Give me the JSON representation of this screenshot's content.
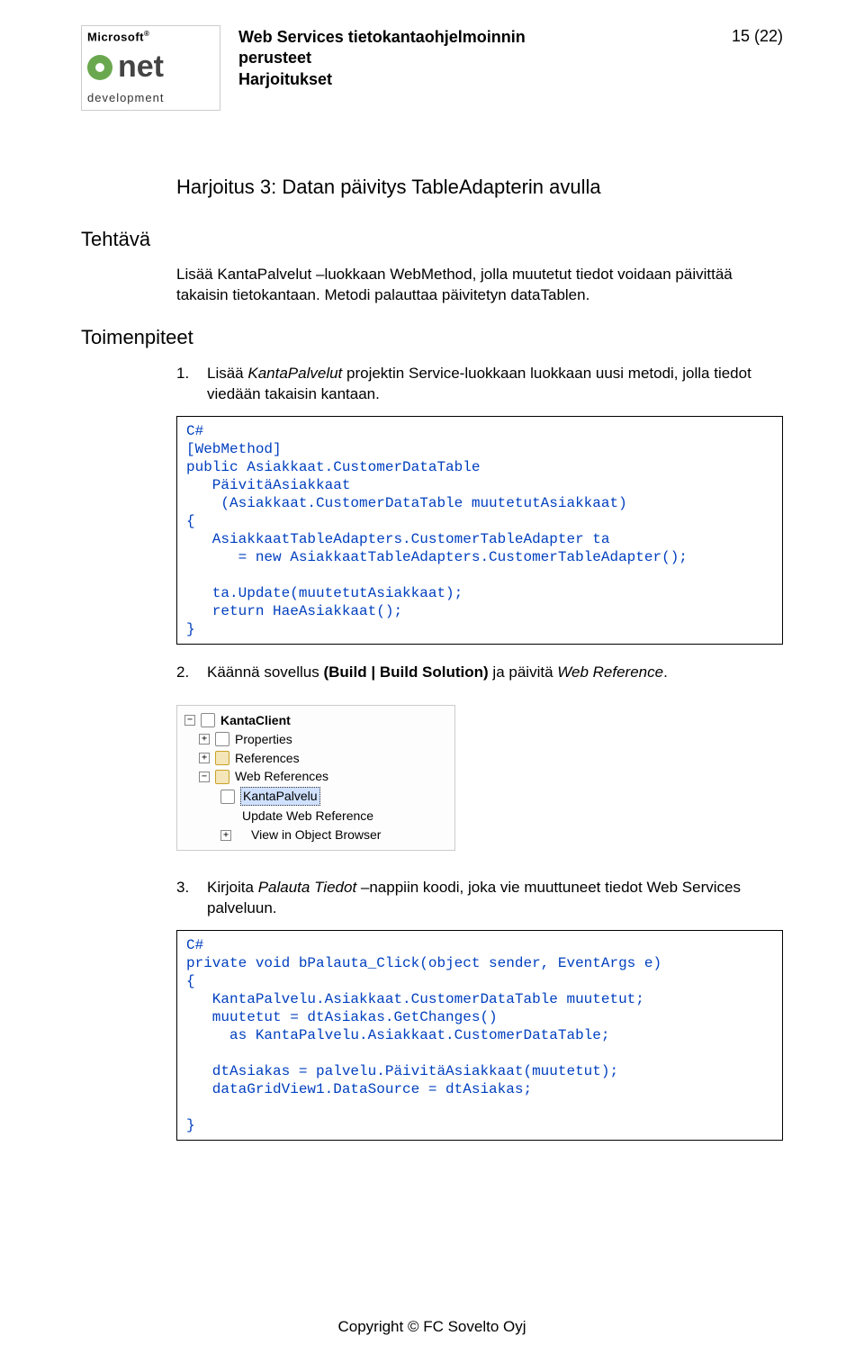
{
  "header": {
    "logo": {
      "ms": "Microsoft",
      "net": "net",
      "dev": "development"
    },
    "title_line1": "Web Services tietokantaohjelmoinnin",
    "title_line2": "perusteet",
    "title_line3": "Harjoitukset",
    "page_indicator": "15 (22)"
  },
  "exercise_title": "Harjoitus 3: Datan päivitys TableAdapterin avulla",
  "labels": {
    "task": "Tehtävä",
    "steps": "Toimenpiteet"
  },
  "task_paragraph": "Lisää KantaPalvelut –luokkaan WebMethod, jolla muutetut tiedot voidaan päivittää takaisin tietokantaan. Metodi palauttaa päivitetyn dataTablen.",
  "steps": {
    "s1_num": "1.",
    "s1_pre": "Lisää ",
    "s1_ital": "KantaPalvelut",
    "s1_post": " projektin Service-luokkaan luokkaan uusi metodi, jolla tiedot viedään takaisin kantaan.",
    "code1": "C#\n[WebMethod]\npublic Asiakkaat.CustomerDataTable\n   PäivitäAsiakkaat\n    (Asiakkaat.CustomerDataTable muutetutAsiakkaat)\n{\n   AsiakkaatTableAdapters.CustomerTableAdapter ta\n      = new AsiakkaatTableAdapters.CustomerTableAdapter();\n\n   ta.Update(muutetutAsiakkaat);\n   return HaeAsiakkaat();\n}",
    "s2_num": "2.",
    "s2_pre": "Käännä sovellus ",
    "s2_bold": "(Build | Build Solution)",
    "s2_mid": " ja päivitä ",
    "s2_ital": "Web Reference",
    "s2_end": ".",
    "s3_num": "3.",
    "s3_pre": "Kirjoita ",
    "s3_ital": "Palauta Tiedot",
    "s3_post": " –nappiin koodi, joka vie muuttuneet tiedot Web Services palveluun.",
    "code2": "C#\nprivate void bPalauta_Click(object sender, EventArgs e)\n{\n   KantaPalvelu.Asiakkaat.CustomerDataTable muutetut;\n   muutetut = dtAsiakas.GetChanges()\n     as KantaPalvelu.Asiakkaat.CustomerDataTable;\n\n   dtAsiakas = palvelu.PäivitäAsiakkaat(muutetut);\n   dataGridView1.DataSource = dtAsiakas;\n\n}"
  },
  "tree": {
    "root": "KantaClient",
    "n1": "Properties",
    "n2": "References",
    "n3": "Web References",
    "n3a": "KantaPalvelu",
    "menu1": "Update Web Reference",
    "menu2": "View in Object Browser",
    "exp_plus": "+",
    "exp_minus": "−"
  },
  "footer": "Copyright © FC Sovelto Oyj"
}
